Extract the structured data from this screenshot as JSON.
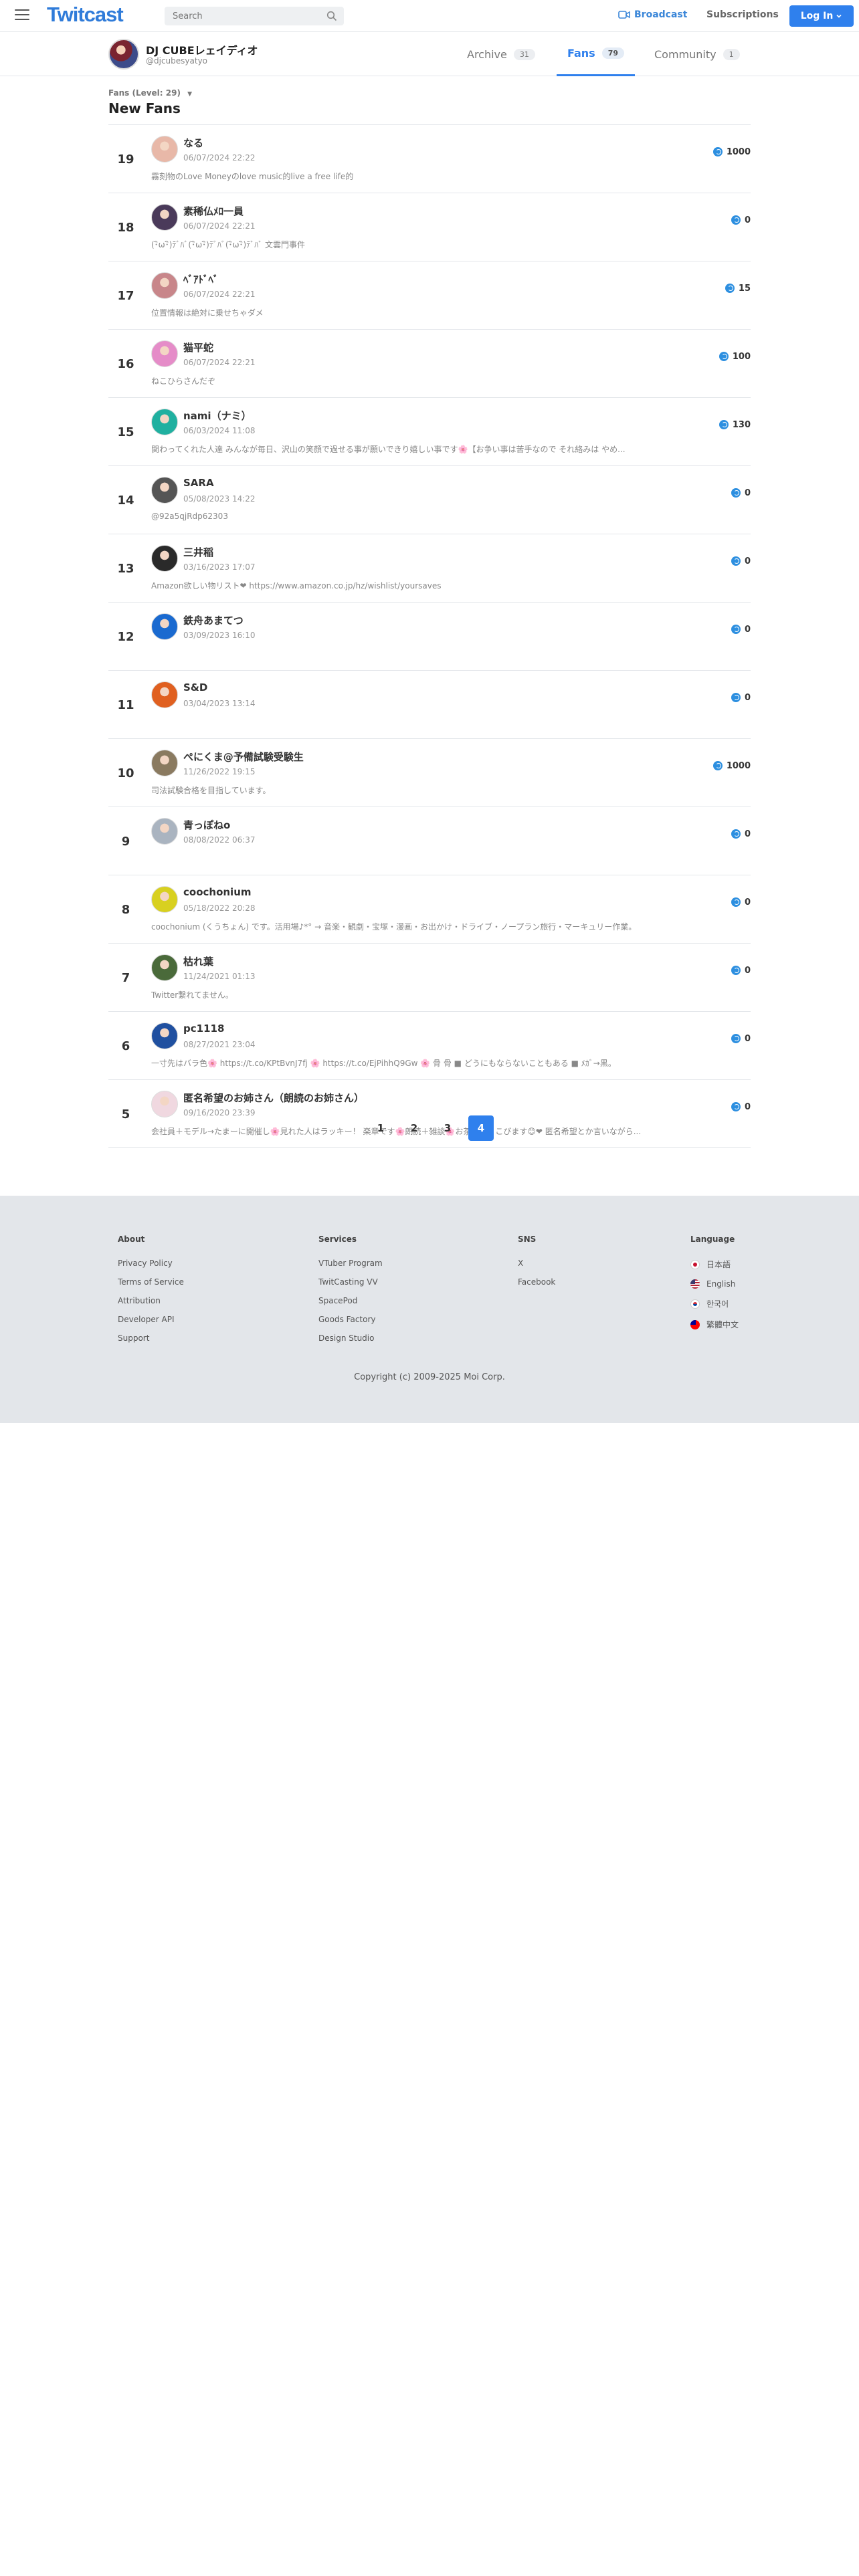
{
  "header": {
    "logo": "Twitcast",
    "search_placeholder": "Search",
    "broadcast_label": "Broadcast",
    "subscriptions_label": "Subscriptions",
    "login_label": "Log In"
  },
  "profile": {
    "name": "DJ CUBEレェイディオ",
    "id": "@djcubesyatyo"
  },
  "tabs": [
    {
      "label": "Archive",
      "count": "31"
    },
    {
      "label": "Fans",
      "count": "79"
    },
    {
      "label": "Community",
      "count": "1"
    }
  ],
  "breadcrumb": "Fans (Level: 29)",
  "page_title": "New Fans",
  "fans": [
    {
      "rank": "19",
      "name": "なる",
      "date": "06/07/2024 22:22",
      "bio": "霧刻物のLove Moneyのlove music的live a free life的",
      "points": "1000",
      "avatar_color": "#e8b8a8"
    },
    {
      "rank": "18",
      "name": "素稀仏ﾒﾛ一員",
      "date": "06/07/2024 22:21",
      "bio": "(･ิω･ิ)ﾃﾞﾊﾞ(･ิω･ิ)ﾃﾞﾊﾞ(･ิω･ิ)ﾃﾞﾊﾞ 文雲門事件",
      "points": "0",
      "avatar_color": "#4a3a5a"
    },
    {
      "rank": "17",
      "name": "ﾍﾞｱﾄﾞﾍﾞ",
      "date": "06/07/2024 22:21",
      "bio": "位置情報は絶対に乗せちゃダメ",
      "points": "15",
      "avatar_color": "#c8868a"
    },
    {
      "rank": "16",
      "name": "猫平蛇",
      "date": "06/07/2024 22:21",
      "bio": "ねこひらさんだぞ",
      "points": "100",
      "avatar_color": "#e58cc8"
    },
    {
      "rank": "15",
      "name": "nami（ナミ）",
      "date": "06/03/2024 11:08",
      "bio": "関わってくれた人達 みんなが毎日、沢山の笑顔で過せる事が願いできり嬉しい事です🌸【お争い事は苦手なので それ絡みは やめ...",
      "points": "130",
      "avatar_color": "#20b0a0"
    },
    {
      "rank": "14",
      "name": "SARA",
      "date": "05/08/2023 14:22",
      "bio": "@92a5qjRdp62303",
      "points": "0",
      "avatar_color": "#555555"
    },
    {
      "rank": "13",
      "name": "三井稲",
      "date": "03/16/2023 17:07",
      "bio": "Amazon欲しい物リスト❤ https://www.amazon.co.jp/hz/wishlist/yoursaves",
      "points": "0",
      "avatar_color": "#2a2a2a"
    },
    {
      "rank": "12",
      "name": "鉄舟あまてつ",
      "date": "03/09/2023 16:10",
      "bio": "",
      "points": "0",
      "avatar_color": "#1a6ad0"
    },
    {
      "rank": "11",
      "name": "S&D",
      "date": "03/04/2023 13:14",
      "bio": "",
      "points": "0",
      "avatar_color": "#e06020"
    },
    {
      "rank": "10",
      "name": "ぺにくま@予備試験受験生",
      "date": "11/26/2022 19:15",
      "bio": "司法試験合格を目指しています。",
      "points": "1000",
      "avatar_color": "#8a7a60"
    },
    {
      "rank": "9",
      "name": "青っぽねo",
      "date": "08/08/2022 06:37",
      "bio": "",
      "points": "0",
      "avatar_color": "#aab4c0"
    },
    {
      "rank": "8",
      "name": "coochonium",
      "date": "05/18/2022 20:28",
      "bio": "coochonium (くうちょん) です。活用場♪*° → 音楽・観劇・宝塚・漫画・お出かけ・ドライブ・ノープラン旅行・マーキュリー作業。",
      "points": "0",
      "avatar_color": "#d8d020"
    },
    {
      "rank": "7",
      "name": "枯れ葉",
      "date": "11/24/2021 01:13",
      "bio": "Twitter繋れてません。",
      "points": "0",
      "avatar_color": "#4a6a3a"
    },
    {
      "rank": "6",
      "name": "pc1118",
      "date": "08/27/2021 23:04",
      "bio": "一寸先はバラ色🌸 https://t.co/KPtBvnJ7fj 🌸 https://t.co/EjPihhQ9Gw 🌸 骨 骨 ■ どうにもならないこともある ■ ﾒｶﾞ→黒。",
      "points": "0",
      "avatar_color": "#2050a0"
    },
    {
      "rank": "5",
      "name": "匿名希望のお姉さん（朗読のお姉さん）",
      "date": "09/16/2020 23:39",
      "bio": "会社員＋モデル→たまーに開催し🌸見れた人はラッキー！ 楽章です🌸朗読＋雑談🌸お茶爆ようこびます😊❤ 匿名希望とか言いながら...",
      "points": "0",
      "avatar_color": "#f0d8e0"
    }
  ],
  "pagination": [
    "1",
    "2",
    "3",
    "4"
  ],
  "footer": {
    "about_title": "About",
    "about": [
      "Privacy Policy",
      "Terms of Service",
      "Attribution",
      "Developer API",
      "Support"
    ],
    "services_title": "Services",
    "services": [
      "VTuber Program",
      "TwitCasting VV",
      "SpacePod",
      "Goods Factory",
      "Design Studio"
    ],
    "sns_title": "SNS",
    "sns": [
      "X",
      "Facebook"
    ],
    "language_title": "Language",
    "languages": [
      {
        "label": "日本語",
        "flag": "jp"
      },
      {
        "label": "English",
        "flag": "us"
      },
      {
        "label": "한국어",
        "flag": "kr"
      },
      {
        "label": "繁體中文",
        "flag": "tw"
      }
    ],
    "copyright": "Copyright (c) 2009-2025 Moi Corp."
  },
  "colors": {
    "accent": "#2f80ed",
    "coin": "#2d8fe0"
  }
}
